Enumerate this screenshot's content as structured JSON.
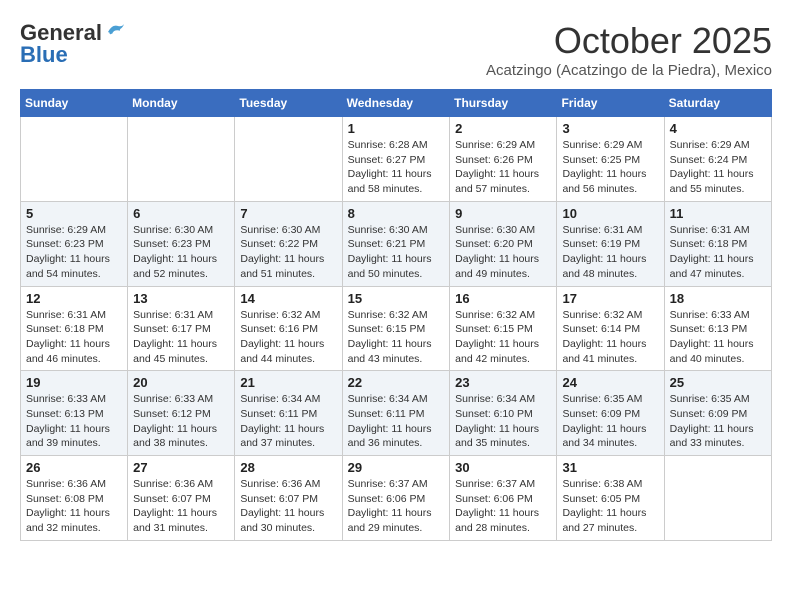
{
  "header": {
    "logo_general": "General",
    "logo_blue": "Blue",
    "month_title": "October 2025",
    "location": "Acatzingo (Acatzingo de la Piedra), Mexico"
  },
  "weekdays": [
    "Sunday",
    "Monday",
    "Tuesday",
    "Wednesday",
    "Thursday",
    "Friday",
    "Saturday"
  ],
  "weeks": [
    [
      {
        "day": "",
        "sunrise": "",
        "sunset": "",
        "daylight": ""
      },
      {
        "day": "",
        "sunrise": "",
        "sunset": "",
        "daylight": ""
      },
      {
        "day": "",
        "sunrise": "",
        "sunset": "",
        "daylight": ""
      },
      {
        "day": "1",
        "sunrise": "Sunrise: 6:28 AM",
        "sunset": "Sunset: 6:27 PM",
        "daylight": "Daylight: 11 hours and 58 minutes."
      },
      {
        "day": "2",
        "sunrise": "Sunrise: 6:29 AM",
        "sunset": "Sunset: 6:26 PM",
        "daylight": "Daylight: 11 hours and 57 minutes."
      },
      {
        "day": "3",
        "sunrise": "Sunrise: 6:29 AM",
        "sunset": "Sunset: 6:25 PM",
        "daylight": "Daylight: 11 hours and 56 minutes."
      },
      {
        "day": "4",
        "sunrise": "Sunrise: 6:29 AM",
        "sunset": "Sunset: 6:24 PM",
        "daylight": "Daylight: 11 hours and 55 minutes."
      }
    ],
    [
      {
        "day": "5",
        "sunrise": "Sunrise: 6:29 AM",
        "sunset": "Sunset: 6:23 PM",
        "daylight": "Daylight: 11 hours and 54 minutes."
      },
      {
        "day": "6",
        "sunrise": "Sunrise: 6:30 AM",
        "sunset": "Sunset: 6:23 PM",
        "daylight": "Daylight: 11 hours and 52 minutes."
      },
      {
        "day": "7",
        "sunrise": "Sunrise: 6:30 AM",
        "sunset": "Sunset: 6:22 PM",
        "daylight": "Daylight: 11 hours and 51 minutes."
      },
      {
        "day": "8",
        "sunrise": "Sunrise: 6:30 AM",
        "sunset": "Sunset: 6:21 PM",
        "daylight": "Daylight: 11 hours and 50 minutes."
      },
      {
        "day": "9",
        "sunrise": "Sunrise: 6:30 AM",
        "sunset": "Sunset: 6:20 PM",
        "daylight": "Daylight: 11 hours and 49 minutes."
      },
      {
        "day": "10",
        "sunrise": "Sunrise: 6:31 AM",
        "sunset": "Sunset: 6:19 PM",
        "daylight": "Daylight: 11 hours and 48 minutes."
      },
      {
        "day": "11",
        "sunrise": "Sunrise: 6:31 AM",
        "sunset": "Sunset: 6:18 PM",
        "daylight": "Daylight: 11 hours and 47 minutes."
      }
    ],
    [
      {
        "day": "12",
        "sunrise": "Sunrise: 6:31 AM",
        "sunset": "Sunset: 6:18 PM",
        "daylight": "Daylight: 11 hours and 46 minutes."
      },
      {
        "day": "13",
        "sunrise": "Sunrise: 6:31 AM",
        "sunset": "Sunset: 6:17 PM",
        "daylight": "Daylight: 11 hours and 45 minutes."
      },
      {
        "day": "14",
        "sunrise": "Sunrise: 6:32 AM",
        "sunset": "Sunset: 6:16 PM",
        "daylight": "Daylight: 11 hours and 44 minutes."
      },
      {
        "day": "15",
        "sunrise": "Sunrise: 6:32 AM",
        "sunset": "Sunset: 6:15 PM",
        "daylight": "Daylight: 11 hours and 43 minutes."
      },
      {
        "day": "16",
        "sunrise": "Sunrise: 6:32 AM",
        "sunset": "Sunset: 6:15 PM",
        "daylight": "Daylight: 11 hours and 42 minutes."
      },
      {
        "day": "17",
        "sunrise": "Sunrise: 6:32 AM",
        "sunset": "Sunset: 6:14 PM",
        "daylight": "Daylight: 11 hours and 41 minutes."
      },
      {
        "day": "18",
        "sunrise": "Sunrise: 6:33 AM",
        "sunset": "Sunset: 6:13 PM",
        "daylight": "Daylight: 11 hours and 40 minutes."
      }
    ],
    [
      {
        "day": "19",
        "sunrise": "Sunrise: 6:33 AM",
        "sunset": "Sunset: 6:13 PM",
        "daylight": "Daylight: 11 hours and 39 minutes."
      },
      {
        "day": "20",
        "sunrise": "Sunrise: 6:33 AM",
        "sunset": "Sunset: 6:12 PM",
        "daylight": "Daylight: 11 hours and 38 minutes."
      },
      {
        "day": "21",
        "sunrise": "Sunrise: 6:34 AM",
        "sunset": "Sunset: 6:11 PM",
        "daylight": "Daylight: 11 hours and 37 minutes."
      },
      {
        "day": "22",
        "sunrise": "Sunrise: 6:34 AM",
        "sunset": "Sunset: 6:11 PM",
        "daylight": "Daylight: 11 hours and 36 minutes."
      },
      {
        "day": "23",
        "sunrise": "Sunrise: 6:34 AM",
        "sunset": "Sunset: 6:10 PM",
        "daylight": "Daylight: 11 hours and 35 minutes."
      },
      {
        "day": "24",
        "sunrise": "Sunrise: 6:35 AM",
        "sunset": "Sunset: 6:09 PM",
        "daylight": "Daylight: 11 hours and 34 minutes."
      },
      {
        "day": "25",
        "sunrise": "Sunrise: 6:35 AM",
        "sunset": "Sunset: 6:09 PM",
        "daylight": "Daylight: 11 hours and 33 minutes."
      }
    ],
    [
      {
        "day": "26",
        "sunrise": "Sunrise: 6:36 AM",
        "sunset": "Sunset: 6:08 PM",
        "daylight": "Daylight: 11 hours and 32 minutes."
      },
      {
        "day": "27",
        "sunrise": "Sunrise: 6:36 AM",
        "sunset": "Sunset: 6:07 PM",
        "daylight": "Daylight: 11 hours and 31 minutes."
      },
      {
        "day": "28",
        "sunrise": "Sunrise: 6:36 AM",
        "sunset": "Sunset: 6:07 PM",
        "daylight": "Daylight: 11 hours and 30 minutes."
      },
      {
        "day": "29",
        "sunrise": "Sunrise: 6:37 AM",
        "sunset": "Sunset: 6:06 PM",
        "daylight": "Daylight: 11 hours and 29 minutes."
      },
      {
        "day": "30",
        "sunrise": "Sunrise: 6:37 AM",
        "sunset": "Sunset: 6:06 PM",
        "daylight": "Daylight: 11 hours and 28 minutes."
      },
      {
        "day": "31",
        "sunrise": "Sunrise: 6:38 AM",
        "sunset": "Sunset: 6:05 PM",
        "daylight": "Daylight: 11 hours and 27 minutes."
      },
      {
        "day": "",
        "sunrise": "",
        "sunset": "",
        "daylight": ""
      }
    ]
  ]
}
